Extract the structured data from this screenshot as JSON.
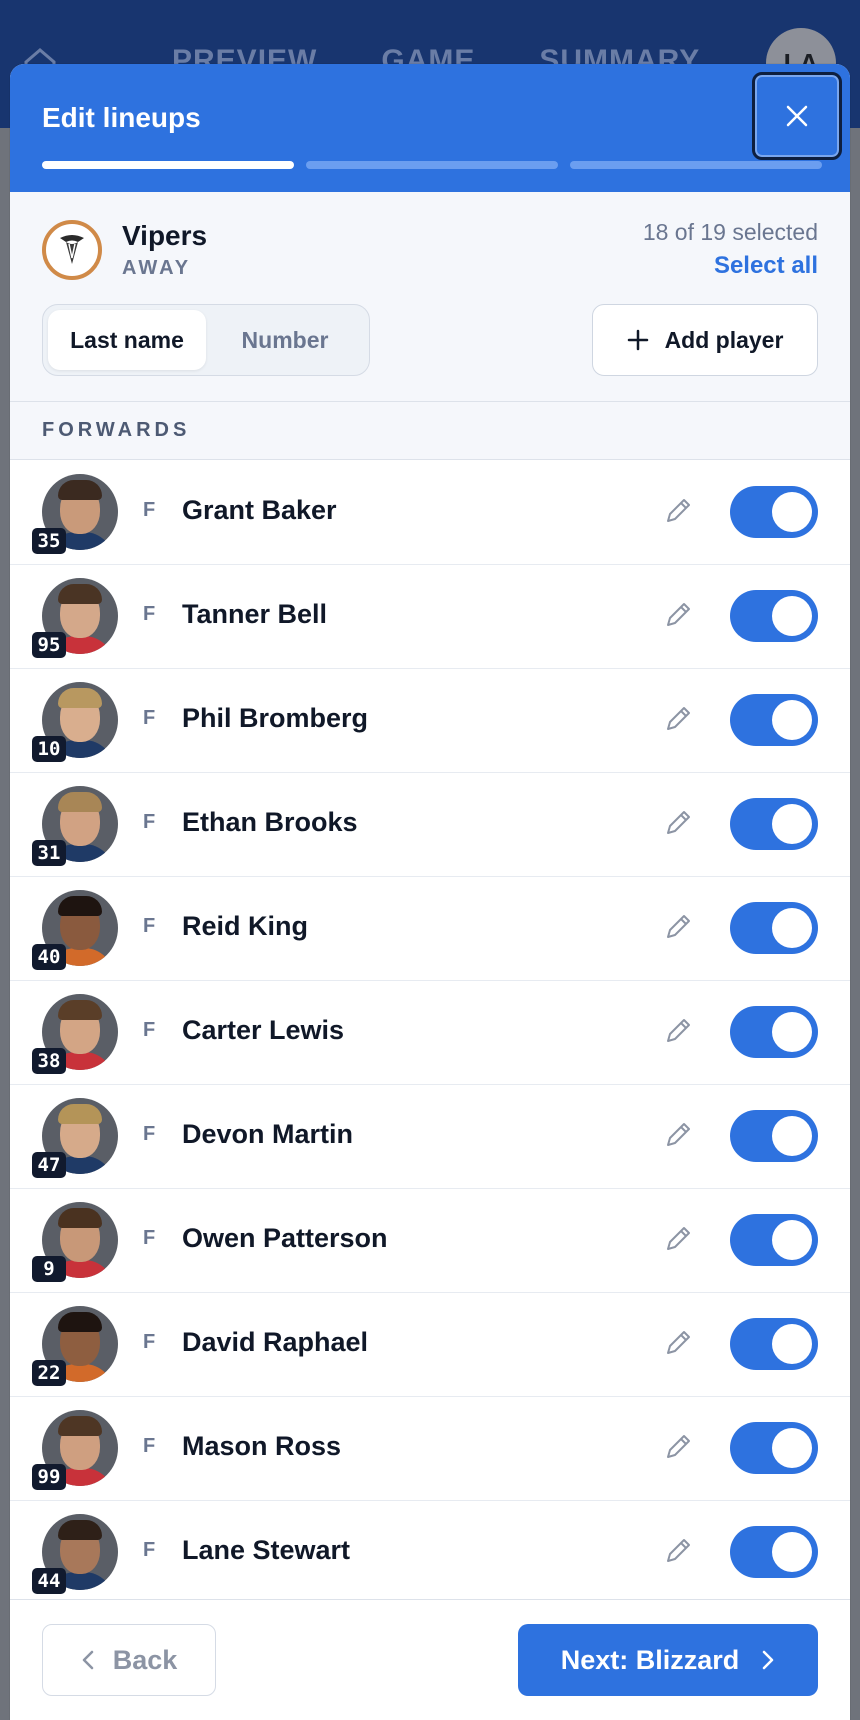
{
  "app_bar": {
    "nav": [
      "PREVIEW",
      "GAME",
      "SUMMARY"
    ],
    "user_initials": "LA"
  },
  "modal": {
    "title": "Edit lineups",
    "close_icon": "close-icon",
    "steps_total": 3,
    "current_step": 1
  },
  "team": {
    "name": "Vipers",
    "side": "AWAY",
    "selected_count": "18 of 19 selected",
    "select_all": "Select all"
  },
  "sort": {
    "options": [
      "Last name",
      "Number"
    ],
    "active": "Last name"
  },
  "add_player": "Add player",
  "section": "FORWARDS",
  "players": [
    {
      "number": "35",
      "position": "F",
      "name": "Grant Baker",
      "enabled": true
    },
    {
      "number": "95",
      "position": "F",
      "name": "Tanner Bell",
      "enabled": true
    },
    {
      "number": "10",
      "position": "F",
      "name": "Phil Bromberg",
      "enabled": true
    },
    {
      "number": "31",
      "position": "F",
      "name": "Ethan Brooks",
      "enabled": true
    },
    {
      "number": "40",
      "position": "F",
      "name": "Reid King",
      "enabled": true
    },
    {
      "number": "38",
      "position": "F",
      "name": "Carter Lewis",
      "enabled": true
    },
    {
      "number": "47",
      "position": "F",
      "name": "Devon Martin",
      "enabled": true
    },
    {
      "number": "9",
      "position": "F",
      "name": "Owen Patterson",
      "enabled": true
    },
    {
      "number": "22",
      "position": "F",
      "name": "David Raphael",
      "enabled": true
    },
    {
      "number": "99",
      "position": "F",
      "name": "Mason Ross",
      "enabled": true
    },
    {
      "number": "44",
      "position": "F",
      "name": "Lane Stewart",
      "enabled": true
    }
  ],
  "footer": {
    "back": "Back",
    "next": "Next: Blizzard"
  },
  "colors": {
    "primary": "#2e72df",
    "app_bar": "#18356f",
    "dark_badge": "#111a2e"
  }
}
